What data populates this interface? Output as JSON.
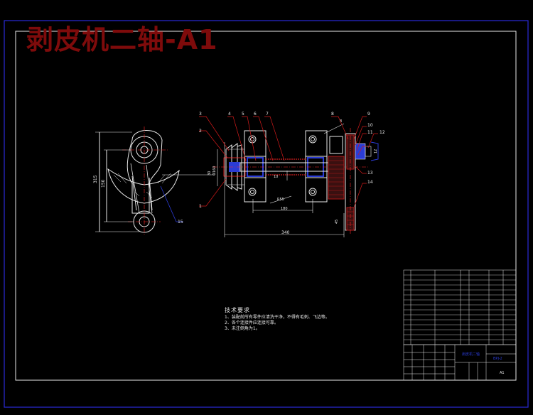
{
  "title": "剥皮机二轴-A1",
  "tech_notes": {
    "heading": "技术要求",
    "lines": [
      "1、装配前所有零件应清洗干净，不得有毛刺、飞边等。",
      "2、各个连接件应连接可靠。",
      "3、未注倒角为1。"
    ]
  },
  "part_callouts": [
    "1",
    "2",
    "3",
    "4",
    "5",
    "6",
    "7",
    "8",
    "9",
    "10",
    "11",
    "12",
    "13",
    "14",
    "15"
  ],
  "dimensions": {
    "overall_length": "340",
    "bearing_span": "180",
    "height_315": "315",
    "height_150": "150",
    "dia_160": "Φ160",
    "d_30": "30",
    "r_55": "R55",
    "d_10": "10",
    "d_8": "8",
    "d_45": "45",
    "d_12": "12"
  },
  "colors": {
    "frame": "#2a2ad8",
    "title": "#7e0b0b",
    "line": "#e8e8e8",
    "leader": "#d21a1a",
    "centerline": "#ff2828",
    "shaft_blue": "#2b3cd6",
    "hatch_red": "#b01818"
  },
  "title_block": {
    "drawing_name": "剥皮机二轴",
    "drawing_code": "BPJ-2",
    "sheet": "A1"
  }
}
